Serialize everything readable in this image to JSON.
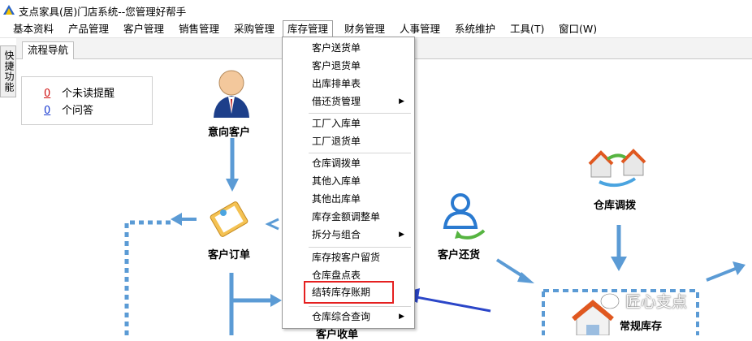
{
  "window": {
    "title": "支点家具(居)门店系统--您管理好帮手"
  },
  "menubar": {
    "items": [
      "基本资料",
      "产品管理",
      "客户管理",
      "销售管理",
      "采购管理",
      "库存管理",
      "财务管理",
      "人事管理",
      "系统维护",
      "工具(T)",
      "窗口(W)"
    ],
    "active_index": 5
  },
  "side_panel": {
    "label": "快捷功能"
  },
  "tabs": [
    "流程导航"
  ],
  "notice": {
    "unread_count": "0",
    "unread_label": "个未读提醒",
    "answer_count": "0",
    "answer_label": "个问答"
  },
  "flow": {
    "prospect_customer": "意向客户",
    "customer_order": "客户订单",
    "customer_return": "客户还货",
    "warehouse_transfer": "仓库调拨",
    "regular_stock": "常规库存",
    "customer_receipt": "客户收单"
  },
  "dropdown": {
    "items": [
      {
        "label": "客户送货单",
        "submenu": false
      },
      {
        "label": "客户退货单",
        "submenu": false
      },
      {
        "label": "出库排单表",
        "submenu": false
      },
      {
        "label": "借还货管理",
        "submenu": true
      },
      {
        "label": "工厂入库单",
        "submenu": false
      },
      {
        "label": "工厂退货单",
        "submenu": false
      },
      {
        "label": "仓库调拨单",
        "submenu": false
      },
      {
        "label": "其他入库单",
        "submenu": false
      },
      {
        "label": "其他出库单",
        "submenu": false
      },
      {
        "label": "库存金额调整单",
        "submenu": false
      },
      {
        "label": "拆分与组合",
        "submenu": true
      },
      {
        "label": "库存按客户留货",
        "submenu": false
      },
      {
        "label": "仓库盘点表",
        "submenu": false
      },
      {
        "label": "结转库存账期",
        "submenu": false
      },
      {
        "label": "仓库综合查询",
        "submenu": true
      }
    ],
    "highlighted_label": "结转库存账期"
  },
  "watermark": "匠心支点",
  "colors": {
    "flow_arrow": "#5b9bd5",
    "dashed_box": "#5b9bd5",
    "highlight": "#e52020",
    "pointer_arrow": "#2b46c8"
  }
}
